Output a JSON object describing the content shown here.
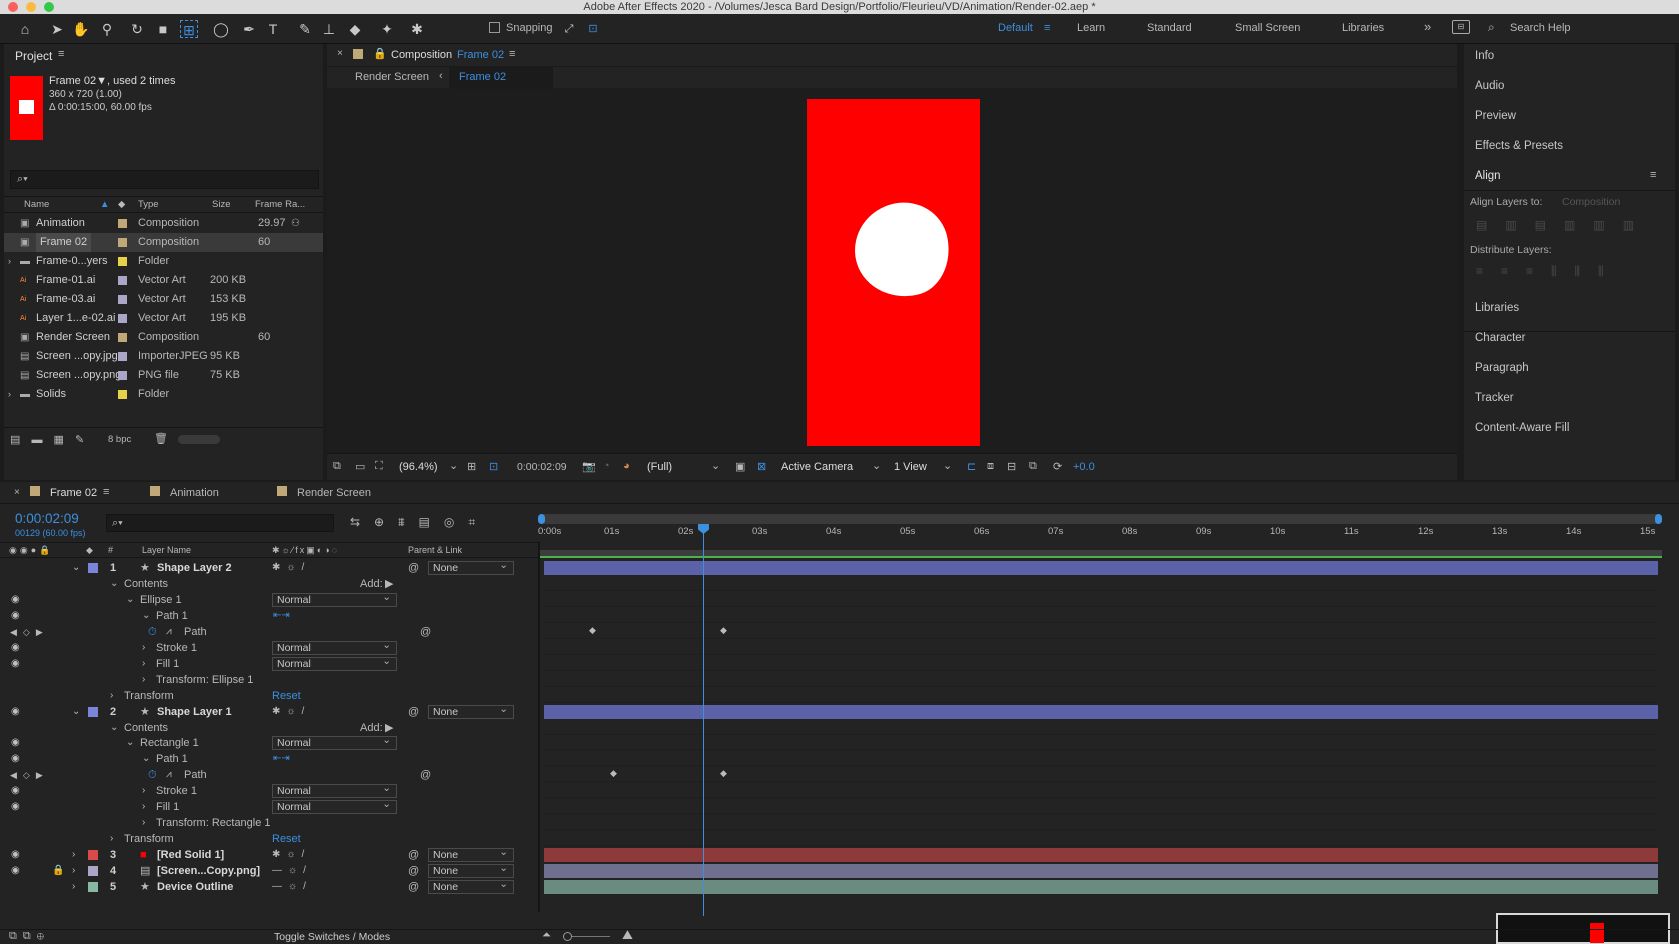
{
  "window": {
    "title": "Adobe After Effects 2020 - /Volumes/Jesca Bard Design/Portfolio/Fleurieu/VD/Animation/Render-02.aep *"
  },
  "toolbar": {
    "snapping_label": "Snapping",
    "workspaces": [
      "Default",
      "Learn",
      "Standard",
      "Small Screen",
      "Libraries"
    ],
    "search_placeholder": "Search Help"
  },
  "project": {
    "panel_title": "Project",
    "item_name": "Frame 02▼",
    "used_text": ", used 2 times",
    "dimensions": "360 x 720 (1.00)",
    "duration": "Δ 0:00:15:00, 60.00 fps",
    "search_placeholder": "",
    "columns": [
      "Name",
      "Type",
      "Size",
      "Frame Ra..."
    ],
    "rows": [
      {
        "name": "Animation",
        "type": "Composition",
        "size": "",
        "rate": "29.97",
        "label": "#c0a878",
        "icon": "comp"
      },
      {
        "name": "Frame 02",
        "type": "Composition",
        "size": "",
        "rate": "60",
        "label": "#c0a878",
        "icon": "comp"
      },
      {
        "name": "Frame-0...yers",
        "type": "Folder",
        "size": "",
        "rate": "",
        "label": "#e6d14a",
        "icon": "folder"
      },
      {
        "name": "Frame-01.ai",
        "type": "Vector Art",
        "size": "200 KB",
        "rate": "",
        "label": "#a9a6c8",
        "icon": "ai"
      },
      {
        "name": "Frame-03.ai",
        "type": "Vector Art",
        "size": "153 KB",
        "rate": "",
        "label": "#a9a6c8",
        "icon": "ai"
      },
      {
        "name": "Layer 1...e-02.ai",
        "type": "Vector Art",
        "size": "195 KB",
        "rate": "",
        "label": "#a9a6c8",
        "icon": "ai"
      },
      {
        "name": "Render Screen",
        "type": "Composition",
        "size": "",
        "rate": "60",
        "label": "#c0a878",
        "icon": "comp"
      },
      {
        "name": "Screen ...opy.jpg",
        "type": "ImporterJPEG",
        "size": "95 KB",
        "rate": "",
        "label": "#a9a6c8",
        "icon": "file"
      },
      {
        "name": "Screen ...opy.png",
        "type": "PNG file",
        "size": "75 KB",
        "rate": "",
        "label": "#a9a6c8",
        "icon": "file"
      },
      {
        "name": "Solids",
        "type": "Folder",
        "size": "",
        "rate": "",
        "label": "#e6d14a",
        "icon": "folder"
      }
    ],
    "bpc": "8 bpc"
  },
  "composition": {
    "tab_prefix": "Composition",
    "tab_name": "Frame 02",
    "breadcrumb": [
      "Render Screen",
      "Frame 02"
    ],
    "zoom": "(96.4%)",
    "timecode": "0:00:02:09",
    "resolution": "(Full)",
    "camera": "Active Camera",
    "view": "1 View",
    "exposure": "+0.0",
    "colors": {
      "red": "#ff0000",
      "white": "#ffffff"
    }
  },
  "right_panel": {
    "items": [
      "Info",
      "Audio",
      "Preview",
      "Effects & Presets"
    ],
    "align_title": "Align",
    "align_layers_to_label": "Align Layers to:",
    "align_layers_to_value": "Composition",
    "distribute_label": "Distribute Layers:",
    "items2": [
      "Libraries",
      "Character",
      "Paragraph",
      "Tracker",
      "Content-Aware Fill"
    ]
  },
  "timeline": {
    "tabs": [
      "Frame 02",
      "Animation",
      "Render Screen"
    ],
    "timecode": "0:00:02:09",
    "frame_info": "00129 (60.00 fps)",
    "ruler": [
      "0:00s",
      "01s",
      "02s",
      "03s",
      "04s",
      "05s",
      "06s",
      "07s",
      "08s",
      "09s",
      "10s",
      "11s",
      "12s",
      "13s",
      "14s",
      "15s"
    ],
    "col_layer_name": "Layer Name",
    "col_parent": "Parent & Link",
    "col_num": "#",
    "rows": [
      {
        "kind": "layer",
        "num": "1",
        "name": "Shape Layer 2",
        "color": "#7b84d8",
        "parent": "None",
        "bar": "#5b62a8"
      },
      {
        "kind": "prop",
        "indent": 1,
        "name": "Contents",
        "extra": "Add:"
      },
      {
        "kind": "prop",
        "indent": 2,
        "name": "Ellipse 1",
        "mode": "Normal"
      },
      {
        "kind": "prop",
        "indent": 3,
        "name": "Path 1"
      },
      {
        "kind": "path",
        "indent": 4,
        "name": "Path"
      },
      {
        "kind": "prop",
        "indent": 3,
        "name": "Stroke 1",
        "mode": "Normal"
      },
      {
        "kind": "prop",
        "indent": 3,
        "name": "Fill 1",
        "mode": "Normal"
      },
      {
        "kind": "prop",
        "indent": 3,
        "name": "Transform: Ellipse 1"
      },
      {
        "kind": "prop",
        "indent": 1,
        "name": "Transform",
        "reset": "Reset"
      },
      {
        "kind": "layer",
        "num": "2",
        "name": "Shape Layer 1",
        "color": "#7b84d8",
        "parent": "None",
        "bar": "#5b62a8"
      },
      {
        "kind": "prop",
        "indent": 1,
        "name": "Contents",
        "extra": "Add:"
      },
      {
        "kind": "prop",
        "indent": 2,
        "name": "Rectangle 1",
        "mode": "Normal"
      },
      {
        "kind": "prop",
        "indent": 3,
        "name": "Path 1"
      },
      {
        "kind": "path",
        "indent": 4,
        "name": "Path"
      },
      {
        "kind": "prop",
        "indent": 3,
        "name": "Stroke 1",
        "mode": "Normal"
      },
      {
        "kind": "prop",
        "indent": 3,
        "name": "Fill 1",
        "mode": "Normal"
      },
      {
        "kind": "prop",
        "indent": 3,
        "name": "Transform: Rectangle 1"
      },
      {
        "kind": "prop",
        "indent": 1,
        "name": "Transform",
        "reset": "Reset"
      },
      {
        "kind": "layer",
        "num": "3",
        "name": "[Red Solid 1]",
        "color": "#d94a4a",
        "parent": "None",
        "bar": "#8f3a3a"
      },
      {
        "kind": "layer",
        "num": "4",
        "name": "[Screen...Copy.png]",
        "color": "#a9a6c8",
        "parent": "None",
        "bar": "#6f6f90"
      },
      {
        "kind": "layer",
        "num": "5",
        "name": "Device Outline",
        "color": "#86b8a4",
        "parent": "None",
        "bar": "#6a8c80"
      }
    ],
    "footer": "Toggle Switches / Modes"
  }
}
